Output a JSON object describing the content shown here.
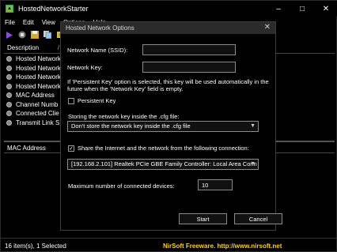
{
  "app": {
    "title": "HostedNetworkStarter",
    "icon_name": "app-icon"
  },
  "window_controls": [
    "–",
    "□",
    "✕"
  ],
  "menu": [
    "File",
    "Edit",
    "View",
    "Options",
    "Help"
  ],
  "toolbar": [
    "play-icon",
    "stop-icon",
    "save-icon",
    "copy-icon",
    "options-icon"
  ],
  "list": {
    "column": "Description",
    "sort_indicator": "/",
    "rows": [
      "Hosted Network",
      "Hosted Network",
      "Hosted Network",
      "Hosted Network",
      "MAC Address",
      "Channel Numb",
      "Connected Clie",
      "Transmit Link S"
    ]
  },
  "detail": {
    "column": "MAC Address"
  },
  "statusbar": {
    "left": "16 item(s), 1 Selected",
    "right": "NirSoft Freeware.  http://www.nirsoft.net"
  },
  "dialog": {
    "title": "Hosted Network Options",
    "close_label": "✕",
    "ssid_label": "Network Name (SSID):",
    "ssid_value": "",
    "key_label": "Network Key:",
    "key_value": "",
    "info_text": "If 'Persistent Key' option is selected, this key will be used automatically in the future when the 'Network Key' field is empty.",
    "persistent_key_label": "Persistent Key",
    "persistent_key_checked": false,
    "storing_label": "Storing the network key inside the .cfg file:",
    "storing_value": "Don't store the network key inside the .cfg file",
    "share_label": "Share the Internet and the network from the following connection:",
    "share_checked": true,
    "connection_value": "[192.168.2.101]  Realtek PCIe GBE Family Controller: Local Area Conn",
    "max_devices_label": "Maximum number of connected devices:",
    "max_devices_value": "10",
    "start_label": "Start",
    "cancel_label": "Cancel"
  },
  "colors": {
    "background": "#000000",
    "dialog_title": "#2b2b2b",
    "link": "#ffcc33",
    "border": "#8a8a8a"
  }
}
